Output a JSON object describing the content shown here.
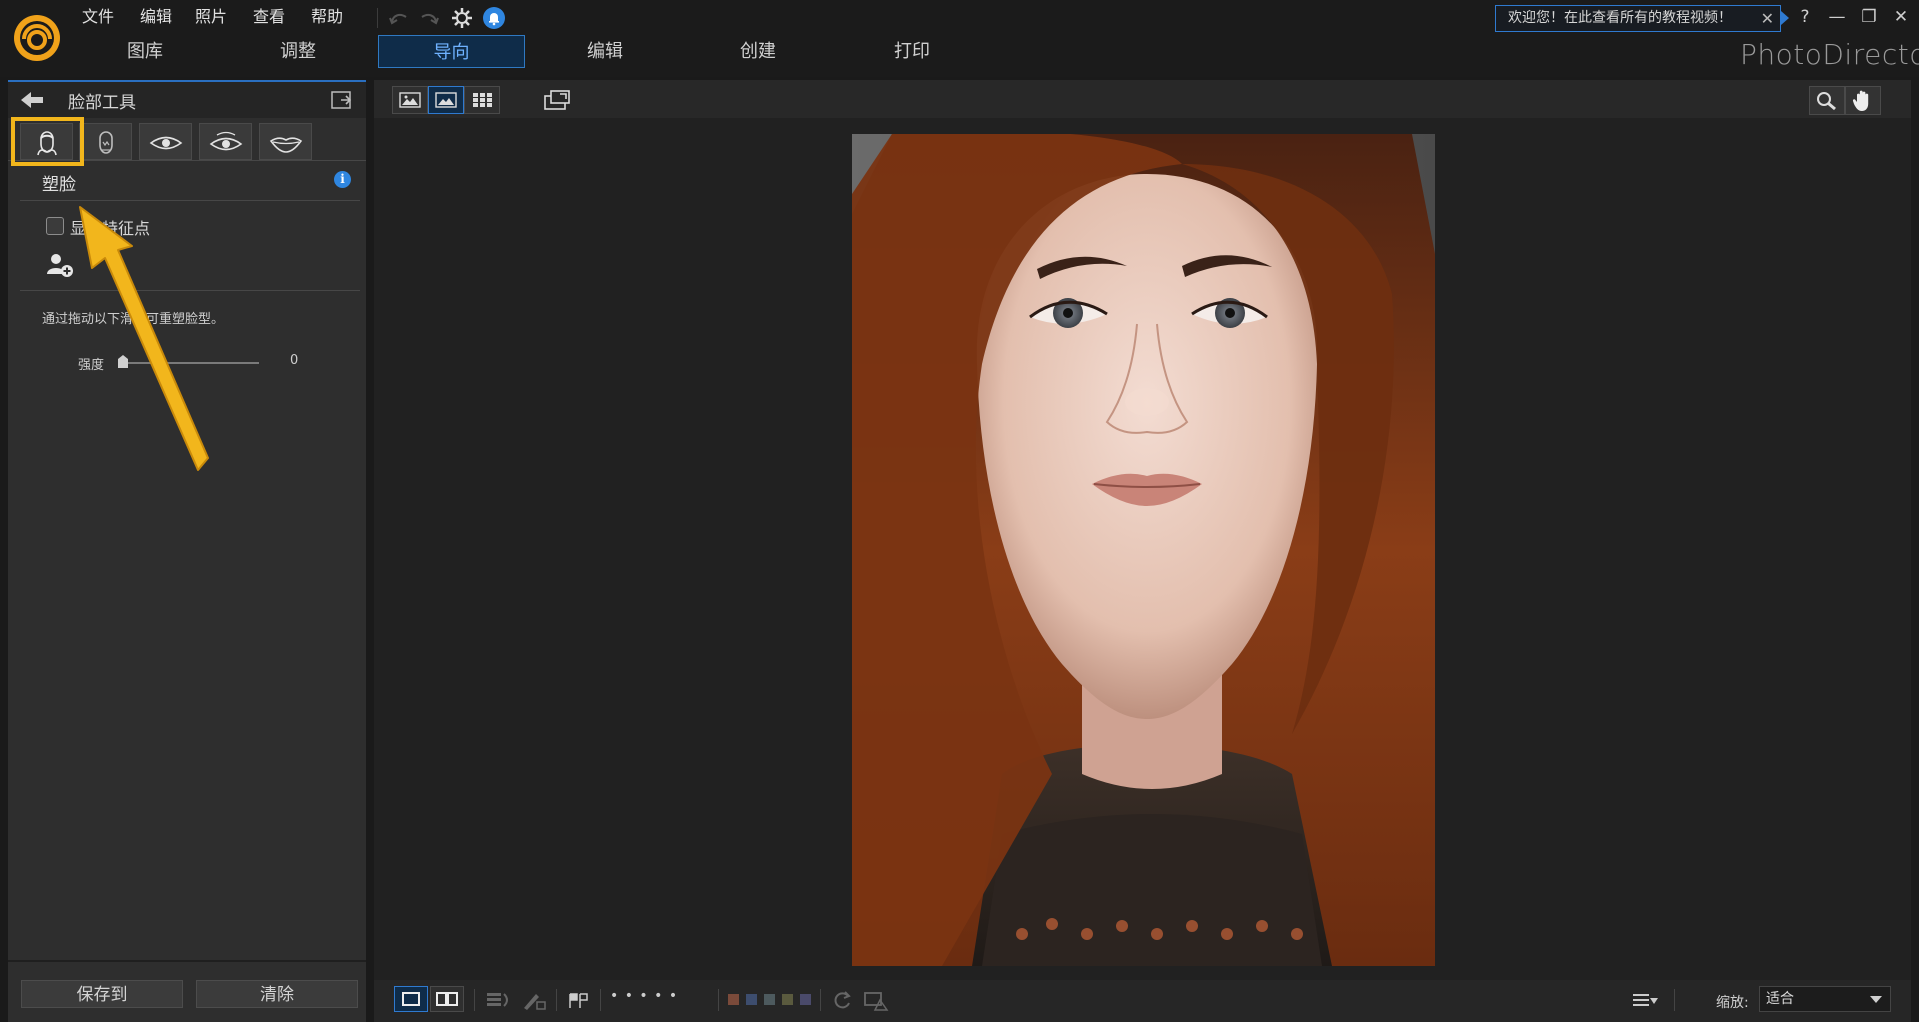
{
  "menu": {
    "file": "文件",
    "edit": "编辑",
    "photo": "照片",
    "view": "查看",
    "help": "帮助"
  },
  "top_tabs": [
    {
      "label": "图库"
    },
    {
      "label": "调整"
    },
    {
      "label": "导向",
      "active": true
    },
    {
      "label": "编辑"
    },
    {
      "label": "创建"
    },
    {
      "label": "打印"
    }
  ],
  "welcome": {
    "text": "欢迎您！在此查看所有的教程视频！",
    "close": "✕"
  },
  "window": {
    "help": "?",
    "minimize": "—",
    "restore": "❐",
    "close": "✕"
  },
  "brand": "PhotoDirector",
  "left_panel": {
    "title": "脸部工具",
    "section_title": "塑脸",
    "info": "i",
    "show_features_label": "显示特征点",
    "description": "通过拖动以下滑块可重塑脸型。",
    "strength_label": "强度",
    "strength_value": "0",
    "save_button": "保存到",
    "clear_button": "清除"
  },
  "bottom": {
    "zoom_label": "缩放:",
    "zoom_value": "适合",
    "rating_dots": "• • • • •"
  },
  "colors": {
    "accent": "#2f7ad0",
    "highlight": "#f2b61c",
    "label_colors": [
      "#7a4a3a",
      "#3d4d6e",
      "#4d5a5e",
      "#5a5a3e",
      "#4a4a6a"
    ]
  },
  "icons": {
    "logo": "photodirector-logo-icon",
    "undo": "undo-icon",
    "redo": "redo-icon",
    "settings": "gear-icon",
    "notification": "bell-icon",
    "back": "back-arrow-icon",
    "popout": "popout-icon",
    "face_tabs": [
      "face-shape-icon",
      "head-icon",
      "eye-icon",
      "eye-enlarge-icon",
      "lips-icon"
    ],
    "add_face": "add-face-icon"
  }
}
